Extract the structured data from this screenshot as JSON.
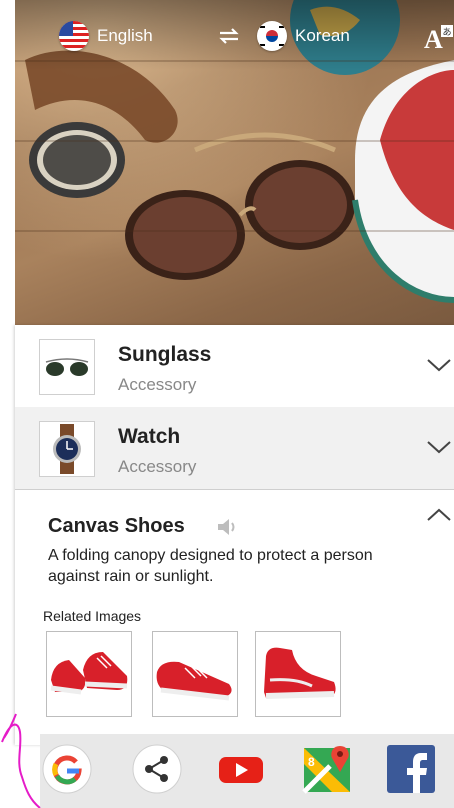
{
  "header": {
    "source_language": "English",
    "target_language": "Korean",
    "swap_icon": "swap-arrows-icon",
    "font_icon": "font-translate-icon"
  },
  "items": [
    {
      "title": "Sunglass",
      "category": "Accessory",
      "expanded": false
    },
    {
      "title": "Watch",
      "category": "Accessory",
      "expanded": false
    }
  ],
  "expanded_item": {
    "title": "Canvas Shoes",
    "description": "A folding canopy designed to protect a person against rain or sunlight.",
    "related_label": "Related Images",
    "related_count": 3
  },
  "share_bar": {
    "apps": [
      "google-icon",
      "share-icon",
      "youtube-icon",
      "maps-icon",
      "facebook-icon"
    ]
  },
  "colors": {
    "google_red": "#ea4335",
    "youtube_red": "#e62117",
    "facebook_blue": "#3b5998",
    "shoe_red": "#d8202a"
  }
}
